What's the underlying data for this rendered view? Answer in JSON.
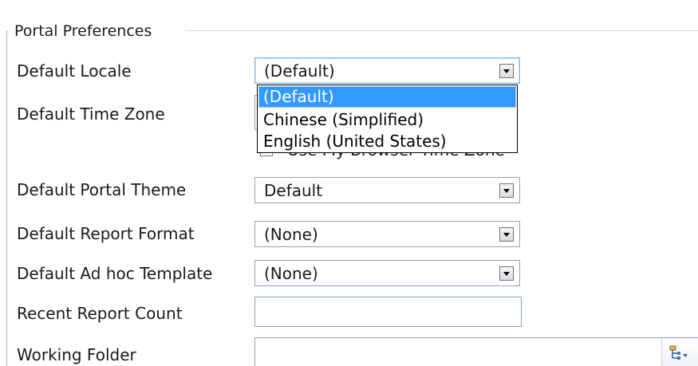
{
  "group": {
    "title": "Portal Preferences"
  },
  "fields": {
    "default_locale": {
      "label": "Default Locale",
      "value": "(Default)"
    },
    "default_time_zone": {
      "label": "Default Time Zone"
    },
    "use_browser_time_zone": {
      "label": "Use My Browser Time Zone",
      "checked": false
    },
    "default_portal_theme": {
      "label": "Default Portal Theme",
      "value": "Default"
    },
    "default_report_format": {
      "label": "Default Report Format",
      "value": "(None)"
    },
    "default_adhoc_template": {
      "label": "Default Ad hoc Template",
      "value": "(None)"
    },
    "recent_report_count": {
      "label": "Recent Report Count",
      "value": ""
    },
    "working_folder": {
      "label": "Working Folder",
      "value": ""
    }
  },
  "locale_dropdown": {
    "options": [
      "(Default)",
      "Chinese (Simplified)",
      "English (United States)"
    ],
    "selected_index": 0
  },
  "icons": {
    "select_arrow": "chevron-down-icon",
    "folder_tree": "folder-tree-icon"
  },
  "colors": {
    "selection": "#3399ff",
    "border": "#8fa3b8",
    "focus_border": "#7eb4ea"
  }
}
